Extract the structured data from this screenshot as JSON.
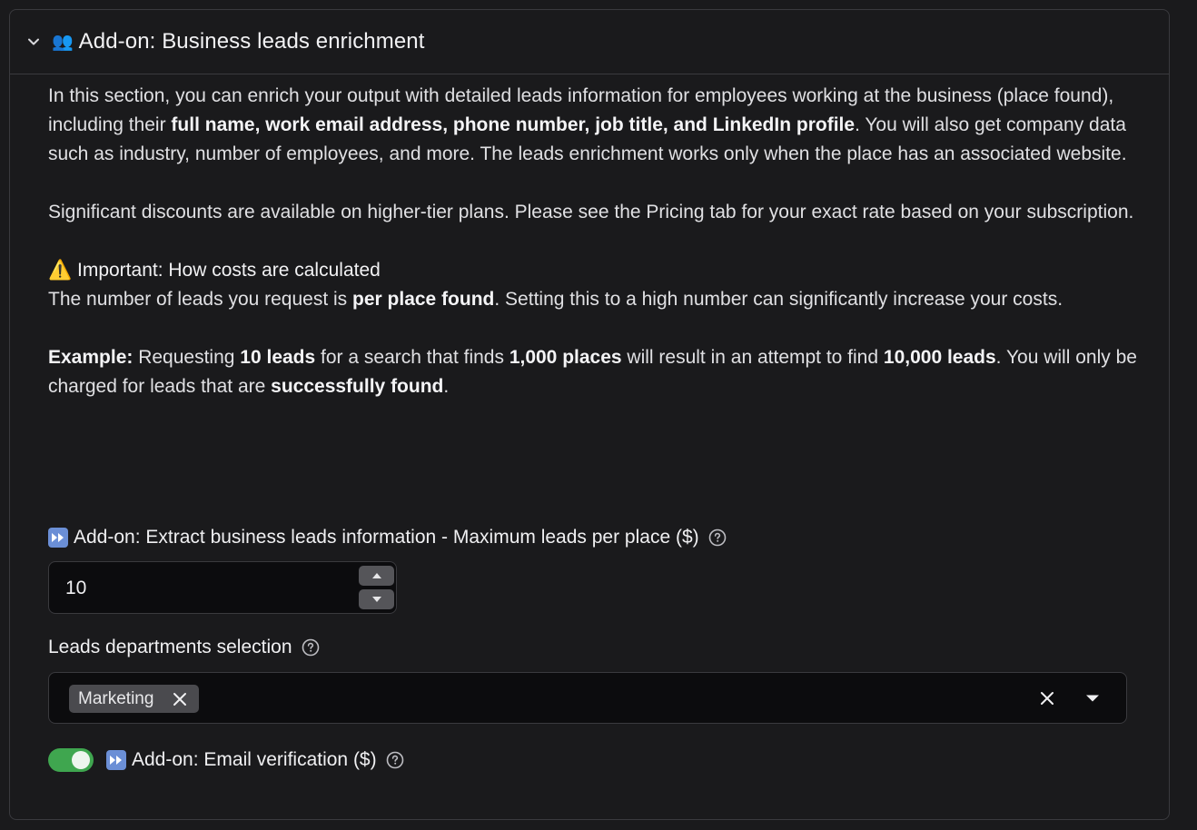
{
  "section": {
    "header_emoji": "👥",
    "title": "Add-on: Business leads enrichment"
  },
  "intro": {
    "p1_part1": "In this section, you can enrich your output with detailed leads information for employees working at the business (place found), including their ",
    "p1_bold": "full name, work email address, phone number, job title, and LinkedIn profile",
    "p1_part2": ". You will also get company data such as industry, number of employees, and more. The leads enrichment works only when the place has an associated website.",
    "p2": "Significant discounts are available on higher-tier plans. Please see the Pricing tab for your exact rate based on your subscription.",
    "warning_emoji": "⚠️",
    "warning_title": "Important: How costs are calculated",
    "p3_part1": "The number of leads you request is ",
    "p3_bold": "per place found",
    "p3_part2": ". Setting this to a high number can significantly increase your costs.",
    "example_label": "Example:",
    "example_part1": " Requesting ",
    "example_bold1": "10 leads",
    "example_part2": " for a search that finds ",
    "example_bold2": "1,000 places",
    "example_part3": " will result in an attempt to find ",
    "example_bold3": "10,000 leads",
    "example_part4": ". You will only be charged for leads that are ",
    "example_bold4": "successfully found",
    "example_part5": "."
  },
  "max_leads": {
    "label": "Add-on: Extract business leads information - Maximum leads per place ($)",
    "value": "10"
  },
  "departments": {
    "label": "Leads departments selection",
    "selected": [
      "Marketing"
    ]
  },
  "email_verification": {
    "label": "Add-on: Email verification ($)",
    "enabled": true
  },
  "colors": {
    "toggle_on": "#3fa64f",
    "background": "#1a1a1c",
    "border": "#3a3a3e"
  },
  "icons": {
    "collapse": "chevron-down-icon",
    "help": "question-circle-icon",
    "fast_forward": "fast-forward-icon",
    "remove": "close-icon",
    "dropdown": "caret-down-icon"
  }
}
